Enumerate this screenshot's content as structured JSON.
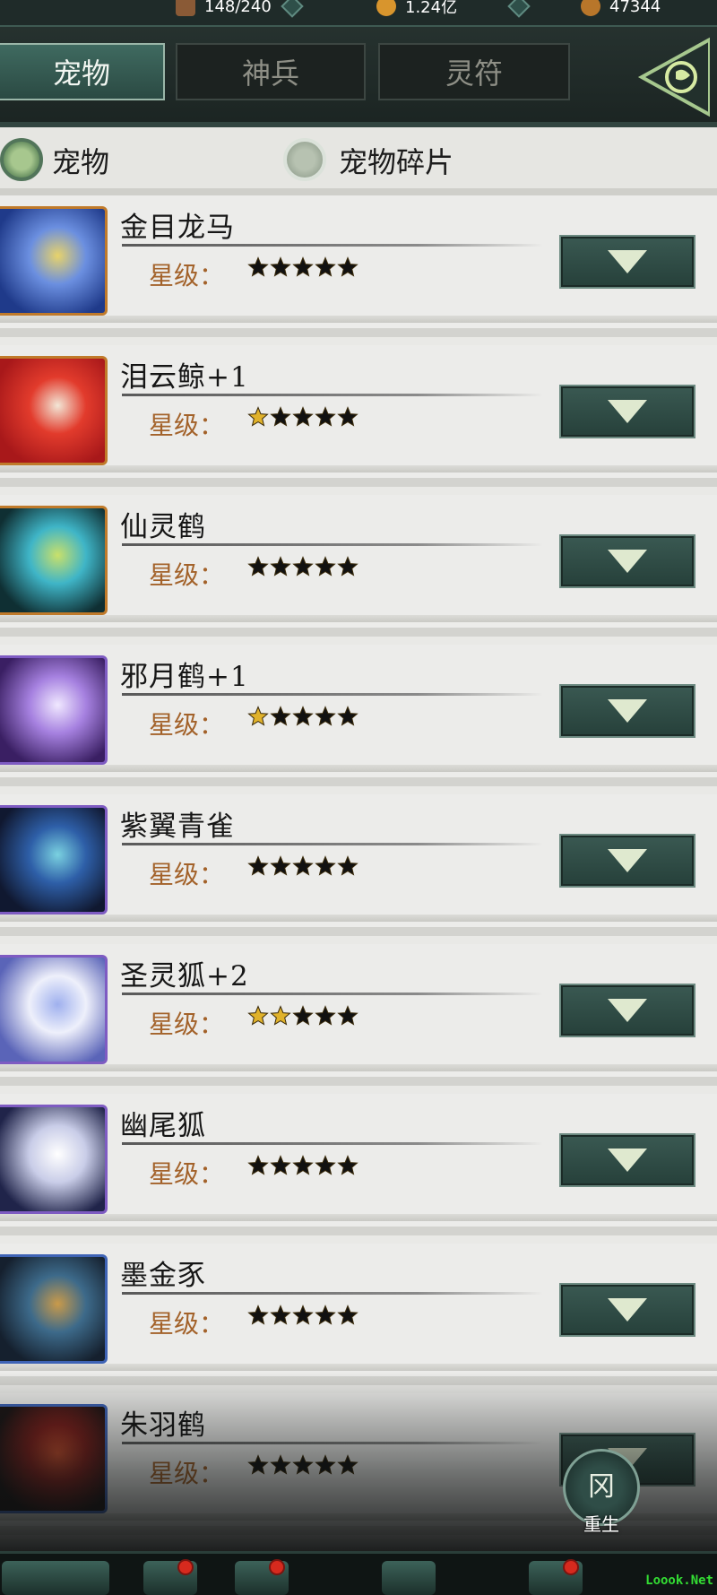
{
  "resources": [
    {
      "value": "148/240",
      "icon": "chest-icon",
      "color": "#8a5a36"
    },
    {
      "value": "1.24亿",
      "icon": "gold-coin-icon",
      "color": "#d8952d"
    },
    {
      "value": "47344",
      "icon": "copper-coin-icon",
      "color": "#b8762a"
    }
  ],
  "tabs": [
    {
      "label": "宠物",
      "active": true
    },
    {
      "label": "神兵",
      "active": false
    },
    {
      "label": "灵符",
      "active": false
    }
  ],
  "filter": {
    "option1": "宠物",
    "option2": "宠物碎片"
  },
  "star_label": "星级：",
  "pets": [
    {
      "name": "金目龙马",
      "stars_gold": 0,
      "frame": "orange",
      "colors": [
        "#1f3a8a",
        "#6b8fe0",
        "#e8d36a"
      ]
    },
    {
      "name": "泪云鲸+1",
      "stars_gold": 1,
      "frame": "orange",
      "colors": [
        "#a8181a",
        "#e23b2c",
        "#f2e6d6"
      ]
    },
    {
      "name": "仙灵鹤",
      "stars_gold": 0,
      "frame": "orange",
      "colors": [
        "#0f2f33",
        "#3fb5c7",
        "#c9e06a"
      ]
    },
    {
      "name": "邪月鹤+1",
      "stars_gold": 1,
      "frame": "purple",
      "colors": [
        "#3a1f63",
        "#a681e0",
        "#f0e8ff"
      ]
    },
    {
      "name": "紫翼青雀",
      "stars_gold": 0,
      "frame": "purple",
      "colors": [
        "#101830",
        "#2e5fa8",
        "#7ad1e0"
      ]
    },
    {
      "name": "圣灵狐+2",
      "stars_gold": 2,
      "frame": "purple",
      "colors": [
        "#5a64b8",
        "#eef0fb",
        "#9fb0ee"
      ]
    },
    {
      "name": "幽尾狐",
      "stars_gold": 0,
      "frame": "purple",
      "colors": [
        "#20244a",
        "#c9cde8",
        "#ffffff"
      ]
    },
    {
      "name": "墨金豕",
      "stars_gold": 0,
      "frame": "blue",
      "colors": [
        "#15202e",
        "#3d6a8a",
        "#c99a4a"
      ]
    },
    {
      "name": "朱羽鹤",
      "stars_gold": 0,
      "frame": "blue",
      "colors": [
        "#1a1414",
        "#7a1e1a",
        "#c24a2a"
      ]
    }
  ],
  "rebirth": {
    "glyph": "冈",
    "label": "重生"
  },
  "watermark": "Loook.Net",
  "colors": {
    "accent": "#2f4d47",
    "star_gold": "#e0b22b",
    "star_dark": "#111111",
    "label_brown": "#a3622a"
  }
}
